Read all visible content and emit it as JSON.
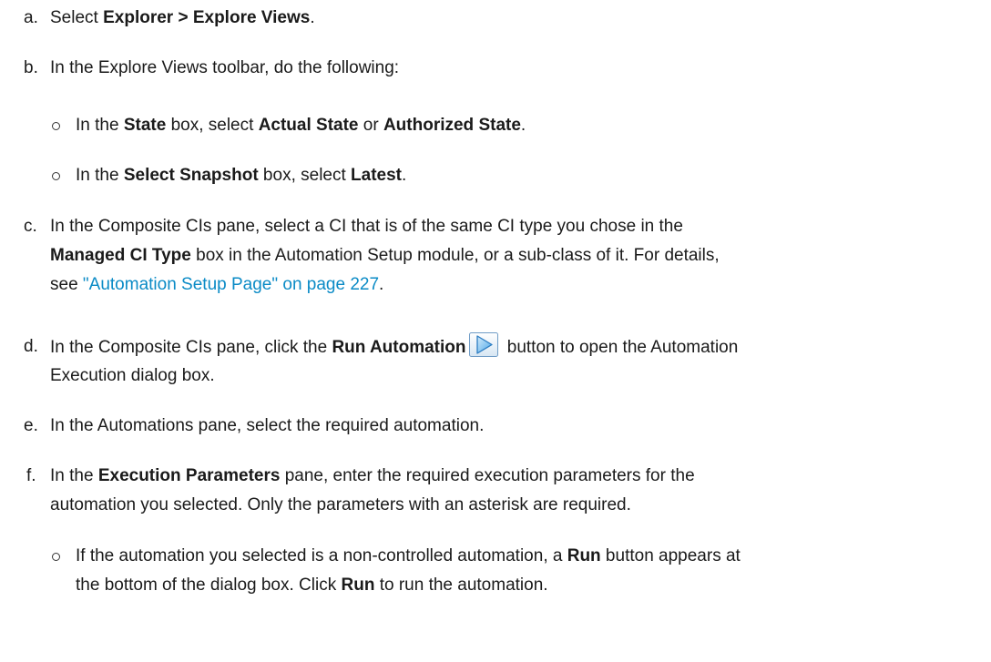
{
  "steps": {
    "a": {
      "marker": "a.",
      "t1": "Select ",
      "b1": "Explorer > Explore Views",
      "t2": "."
    },
    "b": {
      "marker": "b.",
      "text": "In the Explore Views toolbar, do the following:",
      "sub1": {
        "t1": "In the ",
        "b1": "State",
        "t2": " box, select ",
        "b2": "Actual State",
        "t3": " or ",
        "b3": "Authorized State",
        "t4": "."
      },
      "sub2": {
        "t1": "In the ",
        "b1": "Select Snapshot",
        "t2": " box, select ",
        "b2": "Latest",
        "t3": "."
      }
    },
    "c": {
      "marker": "c.",
      "line1": "In the Composite CIs pane, select a CI that is of the same CI type you chose in the",
      "b1": "Managed CI Type",
      "t2": " box in the Automation Setup module, or a sub-class of it. For details,",
      "t3": "see ",
      "link": "\"Automation Setup Page\" on page 227",
      "t4": "."
    },
    "d": {
      "marker": "d.",
      "t1": "In the Composite CIs pane, click the ",
      "b1": "Run Automation",
      "t2": " button to open the Automation",
      "line2": "Execution dialog box.",
      "icon": "run-automation-icon"
    },
    "e": {
      "marker": "e.",
      "text": "In the Automations pane, select the required automation."
    },
    "f": {
      "marker": "f.",
      "t1": "In the ",
      "b1": "Execution Parameters",
      "t2": " pane, enter the required execution parameters for the",
      "line2": "automation you selected. Only the parameters with an asterisk are required.",
      "sub1": {
        "t1": "If the automation you selected is a non-controlled automation, a ",
        "b1": "Run",
        "t2": " button appears at",
        "t3": "the bottom of the dialog box. Click ",
        "b2": "Run",
        "t4": " to run the automation."
      }
    }
  },
  "colors": {
    "text": "#1a1a1a",
    "link": "#0b8bc6"
  }
}
